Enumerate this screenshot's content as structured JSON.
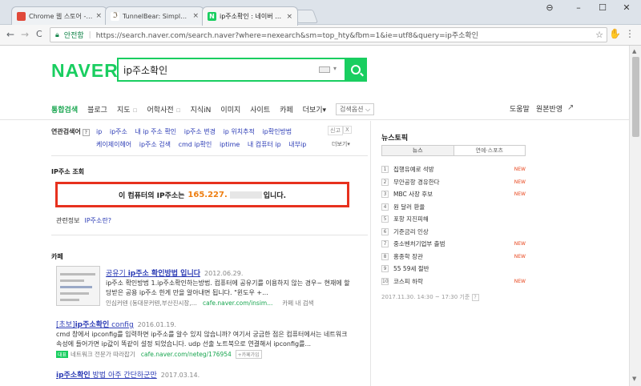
{
  "tabs": [
    {
      "title": "Chrome 웹 스토어 - tun",
      "favicon_color": "#e0493a",
      "active": false
    },
    {
      "title": "TunnelBear: Simple and",
      "favicon_color": "#6b5a44",
      "active": false
    },
    {
      "title": "ip주소확인 : 네이버 통합",
      "favicon_color": "#19ce60",
      "favicon_letter": "N",
      "active": true
    }
  ],
  "toolbar": {
    "back": "←",
    "forward": "→",
    "reload": "C",
    "secure_label": "안전함",
    "url": "https://search.naver.com/search.naver?where=nexearch&sm=top_hty&fbm=1&ie=utf8&query=ip주소확인"
  },
  "header": {
    "logo": "NAVER",
    "query": "ip주소확인"
  },
  "nav": {
    "items": [
      "통합검색",
      "블로그",
      "지도",
      "어학사전",
      "지식iN",
      "이미지",
      "사이트",
      "카페",
      "더보기"
    ],
    "options_label": "검색옵션",
    "right_items": [
      "도움말",
      "원본반영"
    ]
  },
  "related": {
    "label": "연관검색어",
    "row1": [
      "ip",
      "ip주소",
      "내 ip 주소 확인",
      "ip주소 변경",
      "ip 위치추적",
      "ip확인방법"
    ],
    "row2": [
      "케이제이헤어",
      "ip주소 검색",
      "cmd ip확인",
      "iptime",
      "내 컴퓨터 ip",
      "내부ip"
    ],
    "report": "신고",
    "close": "X",
    "more": "더보기"
  },
  "ip_section": {
    "title": "IP주소 조회",
    "prefix": "이 컴퓨터의 IP주소는",
    "ip_visible": "165.227.",
    "suffix": "입니다.",
    "related_info_label": "관련정보",
    "related_info_link": "IP주소란?"
  },
  "cafe": {
    "title": "카페",
    "results": [
      {
        "title_pre": "공유기 ",
        "title_bold": "ip주소 확인방법 입니다",
        "date": "2012.06.29.",
        "line1": "ip주소 확인방법 1.ip주소확인하는방법. 컴퓨터에 공유기를 이용하지 않는 경우~ 현재에 할",
        "line2": "당받은 공용 ip주소 한게 만을 알아내면 됩니다. \"윈도우 +...",
        "meta_author": "인심커텐 (동대문커텐,부산진시장,...",
        "meta_src": "cafe.naver.com/insim...",
        "meta_extra": "카페 내 검색"
      },
      {
        "title_pre": "[초보]",
        "title_bold": "ip주소확인",
        "title_post": " config",
        "date": "2016.01.19.",
        "line1": "cmd 창에서 ipconfig를 입력하면 ip주소를 알수 있지 않습니까? 여기서 궁금한 점은 컴퓨터에서는 네트워크",
        "line2": "속성에 들어가면 ip값이 똑같이 설정 되었습니다. udp 선출 노트북으로 연결해서 ipconfig를...",
        "meta_tag": "대표",
        "meta_author": "네트워크 전문가 따라잡기",
        "meta_src": "cafe.naver.com/neteg/176954",
        "meta_btn": "+카페가입"
      },
      {
        "title_bold": "ip주소확인",
        "title_post": " 방법 아주 간단하군만",
        "date": "2017.03.14."
      }
    ]
  },
  "news": {
    "title": "뉴스토픽",
    "tab_news": "뉴스",
    "tab_ent": "연예·스포츠",
    "items": [
      {
        "num": "1",
        "text": "집행유예로 석방",
        "new": "NEW"
      },
      {
        "num": "2",
        "text": "무안공항 경유한다",
        "new": "NEW"
      },
      {
        "num": "3",
        "text": "MBC 사장 후보",
        "new": "NEW"
      },
      {
        "num": "4",
        "text": "원 달러 환율",
        "new": ""
      },
      {
        "num": "5",
        "text": "포항 지진피해",
        "new": ""
      },
      {
        "num": "6",
        "text": "기준금리 인상",
        "new": ""
      },
      {
        "num": "7",
        "text": "중소벤처기업부 출범",
        "new": "NEW"
      },
      {
        "num": "8",
        "text": "홍종학 장관",
        "new": "NEW"
      },
      {
        "num": "9",
        "text": "55 59세 절반",
        "new": ""
      },
      {
        "num": "10",
        "text": "코스피 하락",
        "new": "NEW"
      }
    ],
    "time": "2017.11.30. 14:30 ~ 17:30 기준"
  },
  "colors": {
    "naver_green": "#19ce60",
    "highlight_red": "#e7311e",
    "ip_orange": "#ee7e11",
    "link_blue": "#2b3bb5"
  }
}
